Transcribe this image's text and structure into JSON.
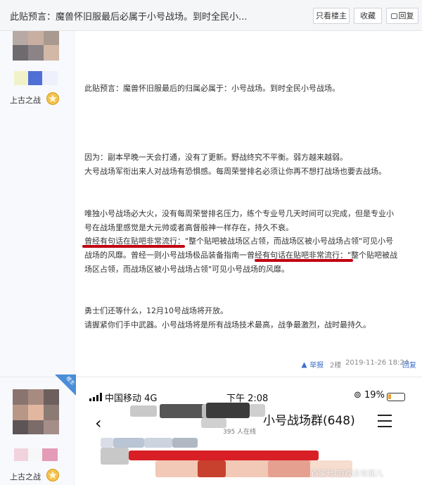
{
  "header": {
    "title": "此贴预言：魔兽怀旧服最后必属于小号战场。到时全民小...",
    "only_op_label": "只看楼主",
    "favorite_label": "收藏",
    "reply_label": "回复"
  },
  "posts": [
    {
      "username": "上古之战",
      "paragraphs": [
        "此贴预言：魔兽怀旧服最后的归属必属于：小号战场。到时全民小号战场。",
        "因为：副本早晚一天会打通，没有了更新。野战终究不平衡。弱方越来越弱。",
        "大号战场军衔出来人对战场有恐惧感。每周荣誉排名必须让你再不想打战场也要去战场。",
        "唯独小号战场必大火，没有每周荣誉排名压力，练个专业号几天时间可以完成，但是专业小",
        "号在战场里感觉是大元帅或者高督般神一样存在，持久不衰。",
        "曾经有句话在贴吧非常流行：\"整个贴吧被战场区占领，而战场区被小号战场占领\"可见小号",
        "战场的风靡。曾经一则小号战场极品装备指南一曾经有句话在贴吧非常流行：\"整个贴吧被战",
        "场区占领，而战场区被小号战场占领\"可见小号战场的风靡。",
        "勇士们还等什么，12月10号战场将开放。",
        "请握紧你们手中武器。小号战场将是所有战场技术最高，战争最激烈，战时最持久。"
      ],
      "footer": {
        "report": "举报",
        "floor": "2楼",
        "time": "2019-11-26 18:24",
        "reply": "回复"
      }
    },
    {
      "username": "上古之战",
      "badge": "楼主"
    }
  ],
  "phone": {
    "carrier": "中国移动",
    "network": "4G",
    "clock": "下午 2:08",
    "battery": "19%",
    "back_glyph": "‹",
    "group_title": "小号战场群(648)",
    "members": "395 人在线"
  },
  "watermark": "百家号/游戏没有面儿",
  "colors": {
    "highlight_underline": "#c00010",
    "link_blue": "#3c6ec9",
    "badge_blue": "#4a8ed8"
  },
  "icons": {
    "level_badge": "star-badge-icon",
    "report": "report-icon",
    "reply": "reply-icon"
  }
}
